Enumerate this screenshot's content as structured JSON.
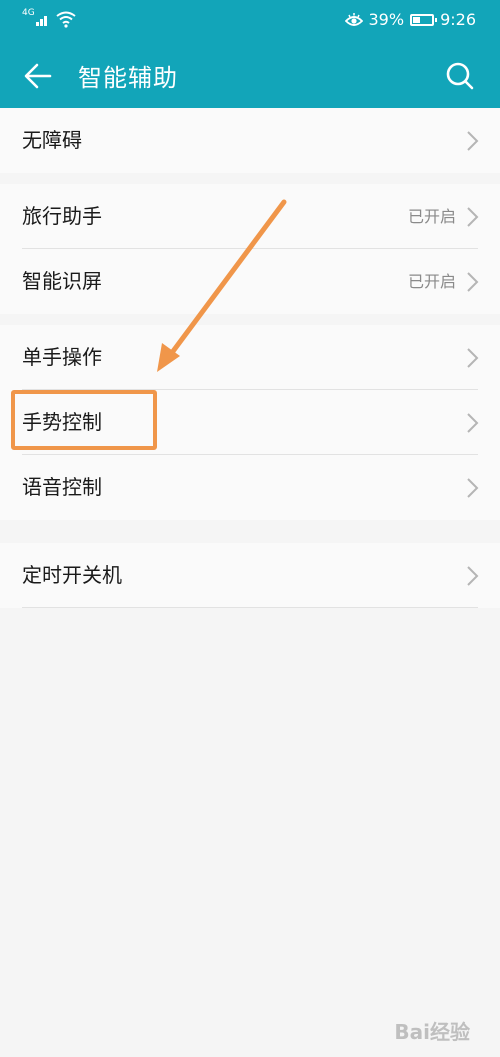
{
  "status_bar": {
    "network": "4G",
    "battery_percent": "39%",
    "time": "9:26"
  },
  "app_bar": {
    "title": "智能辅助"
  },
  "groups": [
    {
      "items": [
        {
          "label": "无障碍",
          "value": ""
        }
      ]
    },
    {
      "items": [
        {
          "label": "旅行助手",
          "value": "已开启"
        },
        {
          "label": "智能识屏",
          "value": "已开启"
        }
      ]
    },
    {
      "items": [
        {
          "label": "单手操作",
          "value": ""
        },
        {
          "label": "手势控制",
          "value": ""
        },
        {
          "label": "语音控制",
          "value": ""
        }
      ]
    },
    {
      "items": [
        {
          "label": "定时开关机",
          "value": ""
        }
      ]
    }
  ],
  "colors": {
    "accent": "#12a5b9",
    "annotation": "#f0964a"
  },
  "icons": [
    "back-arrow-icon",
    "search-icon",
    "chevron-right-icon",
    "eye-comfort-icon",
    "wifi-icon",
    "battery-icon"
  ],
  "watermark": {
    "text": "Bai经验"
  }
}
